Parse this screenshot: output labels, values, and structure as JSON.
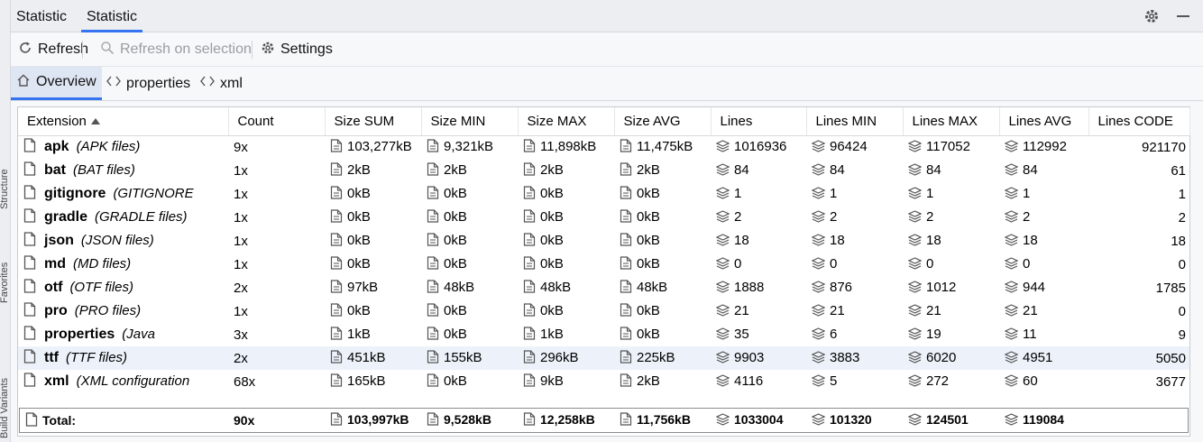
{
  "window": {
    "tabs": [
      {
        "label": "Statistic"
      },
      {
        "label": "Statistic"
      }
    ],
    "actions": {
      "settings_icon": "gear-icon",
      "minimize_icon": "minimize-icon"
    }
  },
  "gutter": {
    "labels": [
      "Structure",
      "Favorites",
      "Build Variants"
    ]
  },
  "toolbar": {
    "refresh_label": "Refresh",
    "refresh_on_selection_label": "Refresh on selection",
    "settings_label": "Settings"
  },
  "subtabs": [
    {
      "label": "Overview"
    },
    {
      "label": "properties"
    },
    {
      "label": "xml"
    }
  ],
  "table": {
    "headers": [
      "Extension",
      "Count",
      "Size SUM",
      "Size MIN",
      "Size MAX",
      "Size AVG",
      "Lines",
      "Lines MIN",
      "Lines MAX",
      "Lines AVG",
      "Lines CODE"
    ],
    "rows": [
      {
        "ext": "apk",
        "desc": "(APK files)",
        "count": "9x",
        "size_sum": "103,277kB",
        "size_min": "9,321kB",
        "size_max": "11,898kB",
        "size_avg": "11,475kB",
        "lines": "1016936",
        "lines_min": "96424",
        "lines_max": "117052",
        "lines_avg": "112992",
        "lines_code": "921170"
      },
      {
        "ext": "bat",
        "desc": "(BAT files)",
        "count": "1x",
        "size_sum": "2kB",
        "size_min": "2kB",
        "size_max": "2kB",
        "size_avg": "2kB",
        "lines": "84",
        "lines_min": "84",
        "lines_max": "84",
        "lines_avg": "84",
        "lines_code": "61"
      },
      {
        "ext": "gitignore",
        "desc": "(GITIGNORE",
        "count": "1x",
        "size_sum": "0kB",
        "size_min": "0kB",
        "size_max": "0kB",
        "size_avg": "0kB",
        "lines": "1",
        "lines_min": "1",
        "lines_max": "1",
        "lines_avg": "1",
        "lines_code": "1"
      },
      {
        "ext": "gradle",
        "desc": "(GRADLE files)",
        "count": "1x",
        "size_sum": "0kB",
        "size_min": "0kB",
        "size_max": "0kB",
        "size_avg": "0kB",
        "lines": "2",
        "lines_min": "2",
        "lines_max": "2",
        "lines_avg": "2",
        "lines_code": "2"
      },
      {
        "ext": "json",
        "desc": "(JSON files)",
        "count": "1x",
        "size_sum": "0kB",
        "size_min": "0kB",
        "size_max": "0kB",
        "size_avg": "0kB",
        "lines": "18",
        "lines_min": "18",
        "lines_max": "18",
        "lines_avg": "18",
        "lines_code": "18"
      },
      {
        "ext": "md",
        "desc": "(MD files)",
        "count": "1x",
        "size_sum": "0kB",
        "size_min": "0kB",
        "size_max": "0kB",
        "size_avg": "0kB",
        "lines": "0",
        "lines_min": "0",
        "lines_max": "0",
        "lines_avg": "0",
        "lines_code": "0"
      },
      {
        "ext": "otf",
        "desc": "(OTF files)",
        "count": "2x",
        "size_sum": "97kB",
        "size_min": "48kB",
        "size_max": "48kB",
        "size_avg": "48kB",
        "lines": "1888",
        "lines_min": "876",
        "lines_max": "1012",
        "lines_avg": "944",
        "lines_code": "1785"
      },
      {
        "ext": "pro",
        "desc": "(PRO files)",
        "count": "1x",
        "size_sum": "0kB",
        "size_min": "0kB",
        "size_max": "0kB",
        "size_avg": "0kB",
        "lines": "21",
        "lines_min": "21",
        "lines_max": "21",
        "lines_avg": "21",
        "lines_code": "0"
      },
      {
        "ext": "properties",
        "desc": "(Java",
        "count": "3x",
        "size_sum": "1kB",
        "size_min": "0kB",
        "size_max": "1kB",
        "size_avg": "0kB",
        "lines": "35",
        "lines_min": "6",
        "lines_max": "19",
        "lines_avg": "11",
        "lines_code": "9"
      },
      {
        "ext": "ttf",
        "desc": "(TTF files)",
        "count": "2x",
        "size_sum": "451kB",
        "size_min": "155kB",
        "size_max": "296kB",
        "size_avg": "225kB",
        "lines": "9903",
        "lines_min": "3883",
        "lines_max": "6020",
        "lines_avg": "4951",
        "lines_code": "5050",
        "highlighted": true
      },
      {
        "ext": "xml",
        "desc": "(XML configuration",
        "count": "68x",
        "size_sum": "165kB",
        "size_min": "0kB",
        "size_max": "9kB",
        "size_avg": "2kB",
        "lines": "4116",
        "lines_min": "5",
        "lines_max": "272",
        "lines_avg": "60",
        "lines_code": "3677"
      }
    ],
    "total": {
      "label": "Total:",
      "count": "90x",
      "size_sum": "103,997kB",
      "size_min": "9,528kB",
      "size_max": "12,258kB",
      "size_avg": "11,756kB",
      "lines": "1033004",
      "lines_min": "101320",
      "lines_max": "124501",
      "lines_avg": "119084"
    }
  },
  "colors": {
    "accent": "#3574f0",
    "row_highlight": "#edf2fa",
    "panel_bg": "#f7f8fa"
  }
}
